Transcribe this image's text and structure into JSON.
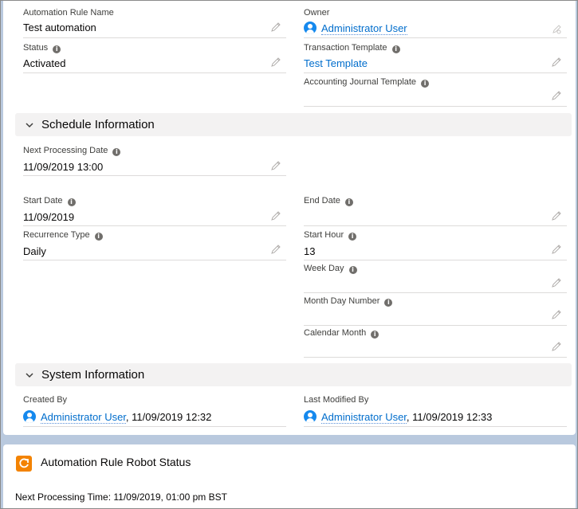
{
  "fields": {
    "rule_name": {
      "label": "Automation Rule Name",
      "value": "Test automation"
    },
    "owner": {
      "label": "Owner",
      "value": "Administrator User"
    },
    "status": {
      "label": "Status",
      "value": "Activated"
    },
    "transaction_template": {
      "label": "Transaction Template",
      "value": "Test Template"
    },
    "accounting_journal_template": {
      "label": "Accounting Journal Template",
      "value": ""
    }
  },
  "schedule": {
    "title": "Schedule Information",
    "next_processing_date": {
      "label": "Next Processing Date",
      "value": "11/09/2019 13:00"
    },
    "start_date": {
      "label": "Start Date",
      "value": "11/09/2019"
    },
    "end_date": {
      "label": "End Date",
      "value": ""
    },
    "recurrence_type": {
      "label": "Recurrence Type",
      "value": "Daily"
    },
    "start_hour": {
      "label": "Start Hour",
      "value": "13"
    },
    "week_day": {
      "label": "Week Day",
      "value": ""
    },
    "month_day_number": {
      "label": "Month Day Number",
      "value": ""
    },
    "calendar_month": {
      "label": "Calendar Month",
      "value": ""
    }
  },
  "system": {
    "title": "System Information",
    "created_by": {
      "label": "Created By",
      "user": "Administrator User",
      "date": ", 11/09/2019 12:32"
    },
    "last_modified_by": {
      "label": "Last Modified By",
      "user": "Administrator User",
      "date": ", 11/09/2019 12:33"
    }
  },
  "robot": {
    "title": "Automation Rule Robot Status",
    "text": "Next Processing Time: 11/09/2019, 01:00 pm BST"
  },
  "colors": {
    "link": "#006dcc",
    "section_bg": "#f3f2f2",
    "avatar": "#1589ee",
    "robot_icon": "#f38303",
    "page_bg": "#b9c9de"
  }
}
